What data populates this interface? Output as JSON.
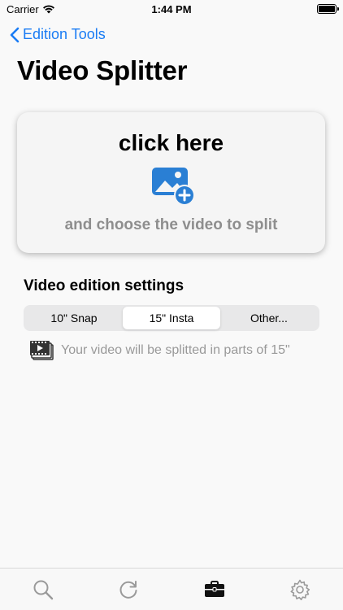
{
  "status": {
    "carrier": "Carrier",
    "time": "1:44 PM"
  },
  "nav": {
    "back_label": "Edition Tools"
  },
  "page": {
    "title": "Video Splitter"
  },
  "picker": {
    "headline": "click here",
    "subtitle": "and choose the video to split",
    "icon": "add-photo-icon"
  },
  "settings": {
    "title": "Video edition settings",
    "segments": [
      "10\" Snap",
      "15\" Insta",
      "Other..."
    ],
    "selected_index": 1,
    "info_text": "Your video will be splitted in parts of 15\""
  },
  "tabbar": {
    "items": [
      "search-icon",
      "refresh-icon",
      "toolbox-icon",
      "settings-gear-icon"
    ],
    "selected_index": 2
  },
  "colors": {
    "accent": "#1a7cf4",
    "icon_blue": "#2a7fd4",
    "muted_text": "#999999"
  }
}
